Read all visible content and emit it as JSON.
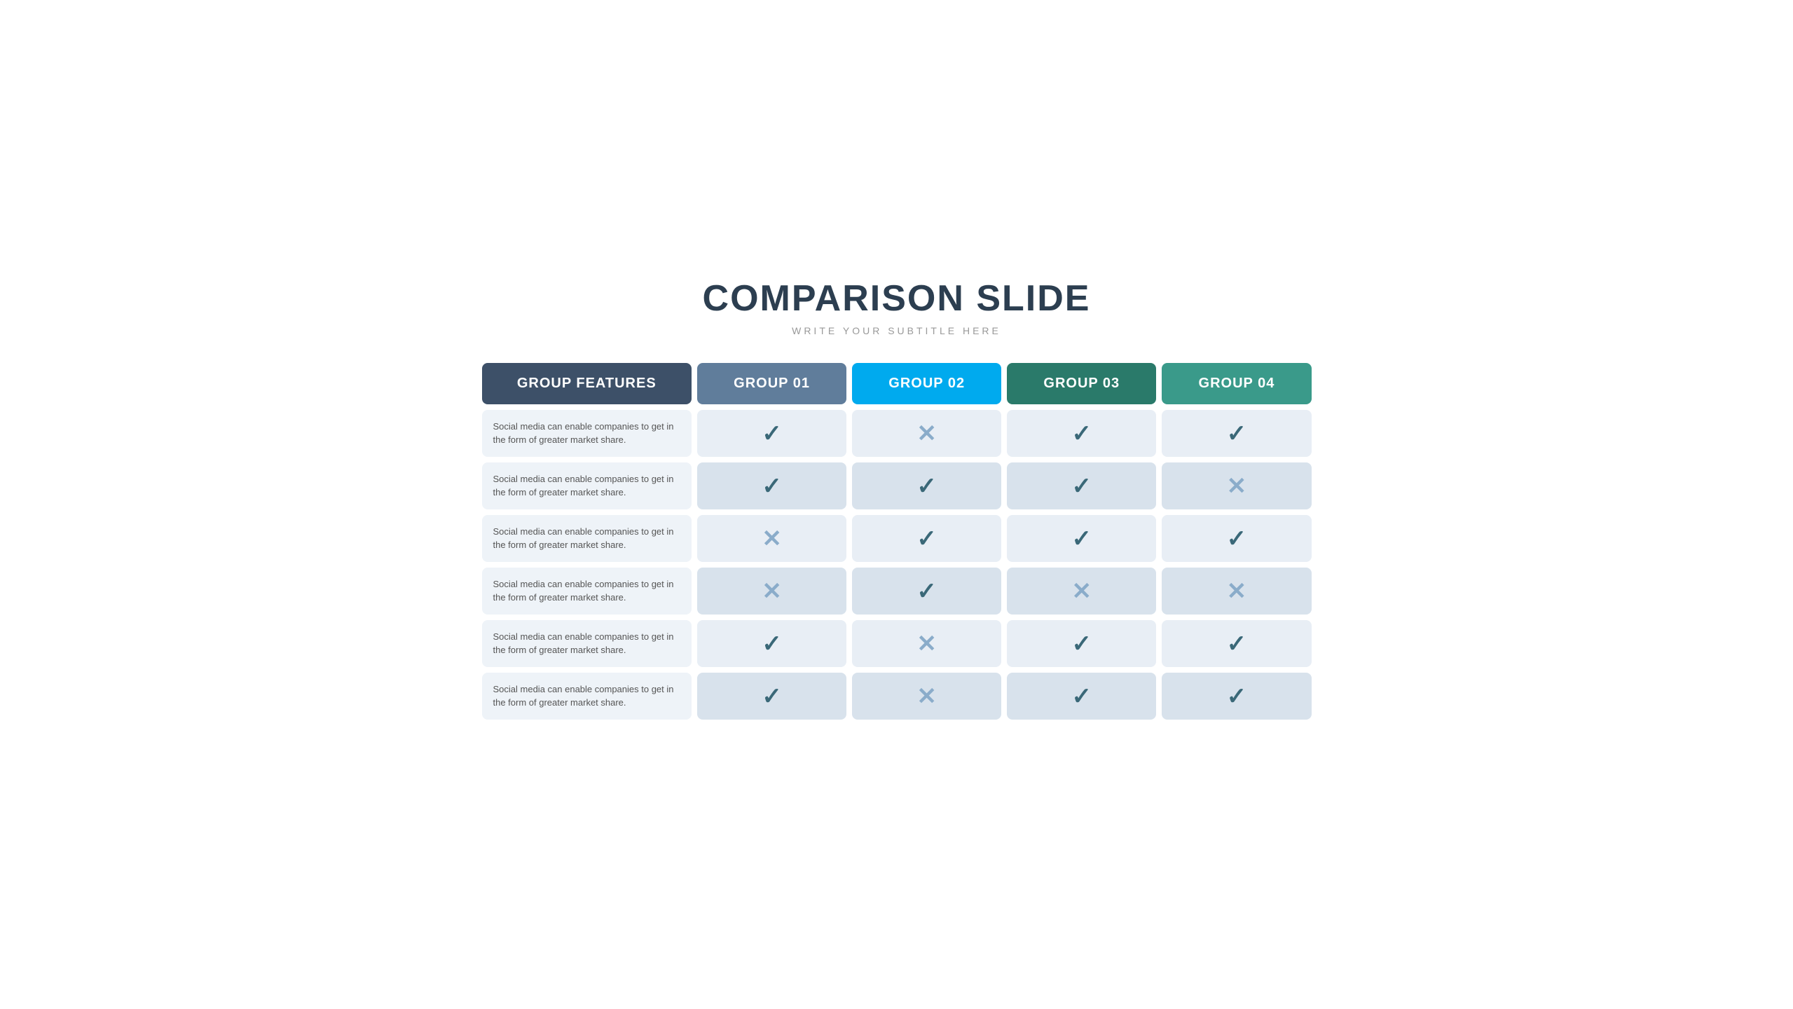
{
  "title": "COMPARISON SLIDE",
  "subtitle": "WRITE YOUR SUBTITLE HERE",
  "headers": {
    "features": "GROUP FEATURES",
    "g1": "GROUP 01",
    "g2": "GROUP 02",
    "g3": "GROUP 03",
    "g4": "GROUP 04"
  },
  "feature_text": "Social media can enable companies to get in the form of greater market share.",
  "rows": [
    {
      "g1": "check",
      "g2": "cross",
      "g3": "check",
      "g4": "check"
    },
    {
      "g1": "check",
      "g2": "check",
      "g3": "check",
      "g4": "cross"
    },
    {
      "g1": "cross",
      "g2": "check",
      "g3": "check",
      "g4": "check"
    },
    {
      "g1": "cross",
      "g2": "check",
      "g3": "cross",
      "g4": "cross"
    },
    {
      "g1": "check",
      "g2": "cross",
      "g3": "check",
      "g4": "check"
    },
    {
      "g1": "check",
      "g2": "cross",
      "g3": "check",
      "g4": "check"
    }
  ]
}
